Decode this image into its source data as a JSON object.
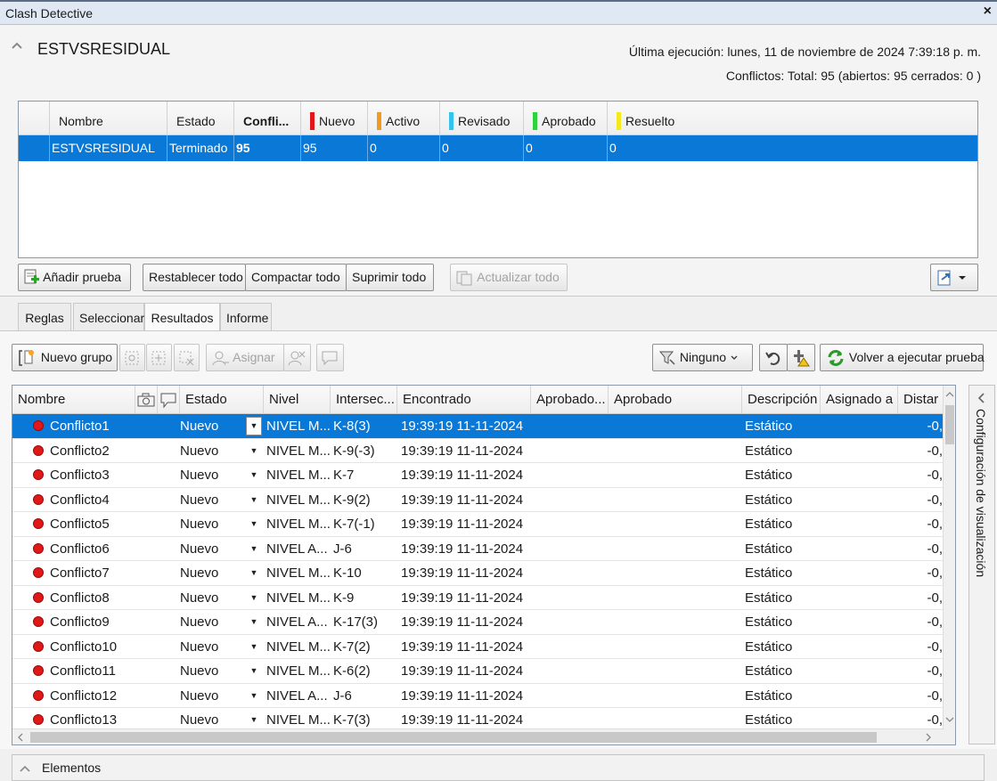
{
  "window": {
    "title": "Clash Detective",
    "close_glyph": "×"
  },
  "test": {
    "name": "ESTVSRESIDUAL",
    "last_run_label": "Última ejecución:",
    "last_run_value": "lunes, 11 de noviembre de 2024 7:39:18 p. m.",
    "summary": "Conflictos: Total: 95 (abiertos: 95 cerrados: 0 )"
  },
  "tests_table": {
    "headers": [
      "Nombre",
      "Estado",
      "Confli...",
      "Nuevo",
      "Activo",
      "Revisado",
      "Aprobado",
      "Resuelto"
    ],
    "status_colors": {
      "nuevo": "#e01818",
      "activo": "#f39a1e",
      "revisado": "#33c3ef",
      "aprobado": "#2fd23a",
      "resuelto": "#f5e81c"
    },
    "row": {
      "name": "ESTVSRESIDUAL",
      "status": "Terminado",
      "conflicts": "95",
      "nuevo": "95",
      "activo": "0",
      "revisado": "0",
      "aprobado": "0",
      "resuelto": "0"
    }
  },
  "toolbar1": {
    "add_test": "Añadir prueba",
    "reset_all": "Restablecer todo",
    "compact_all": "Compactar todo",
    "delete_all": "Suprimir todo",
    "update_all": "Actualizar todo"
  },
  "tabs": [
    "Reglas",
    "Seleccionar",
    "Resultados",
    "Informe"
  ],
  "toolbar2": {
    "new_group": "Nuevo grupo",
    "assign": "Asignar",
    "filter_value": "Ninguno",
    "rerun": "Volver a ejecutar prueba"
  },
  "results": {
    "headers": [
      "Nombre",
      "Estado",
      "Nivel",
      "Intersec...",
      "Encontrado",
      "Aprobado...",
      "Aprobado",
      "Descripción",
      "Asignado a",
      "Distar"
    ],
    "rows": [
      {
        "name": "Conflicto1",
        "status": "Nuevo",
        "level": "NIVEL M...",
        "grid": "K-8(3)",
        "found": "19:39:19 11-11-2024",
        "desc": "Estático",
        "dist": "-0,"
      },
      {
        "name": "Conflicto2",
        "status": "Nuevo",
        "level": "NIVEL M...",
        "grid": "K-9(-3)",
        "found": "19:39:19 11-11-2024",
        "desc": "Estático",
        "dist": "-0,"
      },
      {
        "name": "Conflicto3",
        "status": "Nuevo",
        "level": "NIVEL M...",
        "grid": "K-7",
        "found": "19:39:19 11-11-2024",
        "desc": "Estático",
        "dist": "-0,"
      },
      {
        "name": "Conflicto4",
        "status": "Nuevo",
        "level": "NIVEL M...",
        "grid": "K-9(2)",
        "found": "19:39:19 11-11-2024",
        "desc": "Estático",
        "dist": "-0,"
      },
      {
        "name": "Conflicto5",
        "status": "Nuevo",
        "level": "NIVEL M...",
        "grid": "K-7(-1)",
        "found": "19:39:19 11-11-2024",
        "desc": "Estático",
        "dist": "-0,"
      },
      {
        "name": "Conflicto6",
        "status": "Nuevo",
        "level": "NIVEL A...",
        "grid": "J-6",
        "found": "19:39:19 11-11-2024",
        "desc": "Estático",
        "dist": "-0,"
      },
      {
        "name": "Conflicto7",
        "status": "Nuevo",
        "level": "NIVEL M...",
        "grid": "K-10",
        "found": "19:39:19 11-11-2024",
        "desc": "Estático",
        "dist": "-0,"
      },
      {
        "name": "Conflicto8",
        "status": "Nuevo",
        "level": "NIVEL M...",
        "grid": "K-9",
        "found": "19:39:19 11-11-2024",
        "desc": "Estático",
        "dist": "-0,"
      },
      {
        "name": "Conflicto9",
        "status": "Nuevo",
        "level": "NIVEL A...",
        "grid": "K-17(3)",
        "found": "19:39:19 11-11-2024",
        "desc": "Estático",
        "dist": "-0,"
      },
      {
        "name": "Conflicto10",
        "status": "Nuevo",
        "level": "NIVEL M...",
        "grid": "K-7(2)",
        "found": "19:39:19 11-11-2024",
        "desc": "Estático",
        "dist": "-0,"
      },
      {
        "name": "Conflicto11",
        "status": "Nuevo",
        "level": "NIVEL M...",
        "grid": "K-6(2)",
        "found": "19:39:19 11-11-2024",
        "desc": "Estático",
        "dist": "-0,"
      },
      {
        "name": "Conflicto12",
        "status": "Nuevo",
        "level": "NIVEL A...",
        "grid": "J-6",
        "found": "19:39:19 11-11-2024",
        "desc": "Estático",
        "dist": "-0,"
      },
      {
        "name": "Conflicto13",
        "status": "Nuevo",
        "level": "NIVEL M...",
        "grid": "K-7(3)",
        "found": "19:39:19 11-11-2024",
        "desc": "Estático",
        "dist": "-0,"
      }
    ]
  },
  "side_panel": {
    "label": "Configuración de visualización"
  },
  "bottom_panel": {
    "label": "Elementos"
  },
  "colors": {
    "selection": "#0a78d6",
    "conflict_dot": "#e01818"
  }
}
